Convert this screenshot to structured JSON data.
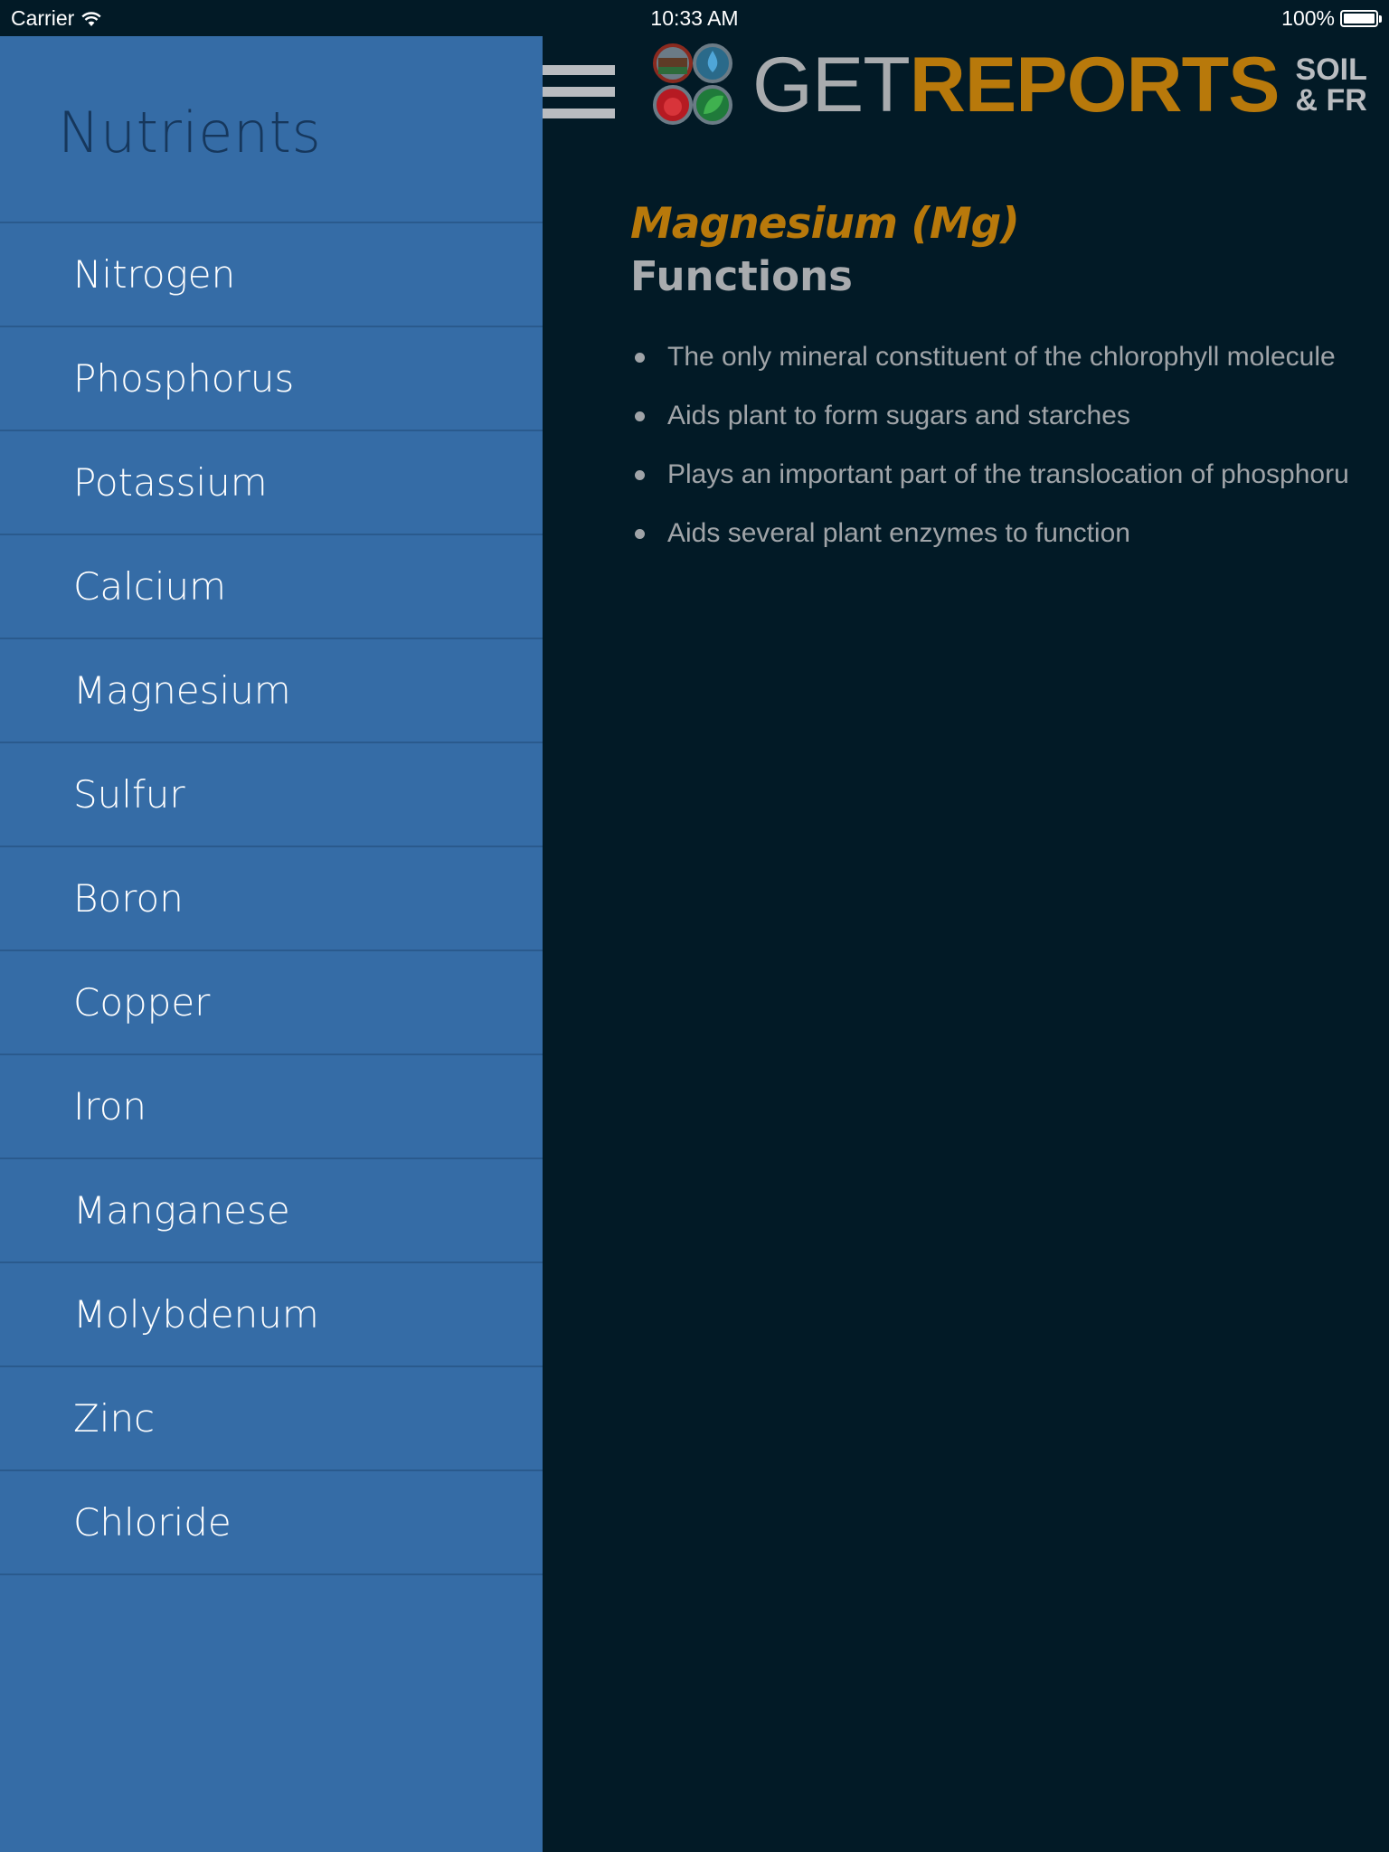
{
  "status_bar": {
    "carrier": "Carrier",
    "time": "10:33 AM",
    "battery": "100%",
    "battery_level": 1.0
  },
  "sidebar": {
    "title": "Nutrients",
    "items": [
      {
        "label": "Nitrogen"
      },
      {
        "label": "Phosphorus"
      },
      {
        "label": "Potassium"
      },
      {
        "label": "Calcium"
      },
      {
        "label": "Magnesium"
      },
      {
        "label": "Sulfur"
      },
      {
        "label": "Boron"
      },
      {
        "label": "Copper"
      },
      {
        "label": "Iron"
      },
      {
        "label": "Manganese"
      },
      {
        "label": "Molybdenum"
      },
      {
        "label": "Zinc"
      },
      {
        "label": "Chloride"
      }
    ]
  },
  "header": {
    "menu_icon": "hamburger-menu-icon",
    "logo": {
      "part1": "GET",
      "part2": "REPORTS",
      "tag_line1": "SOIL",
      "tag_line2": "& FR",
      "icon": "logo-droplets-icon"
    }
  },
  "content": {
    "title": "Magnesium (Mg)",
    "subtitle": "Functions",
    "bullets": [
      "The only mineral constituent of the chlorophyll molecule",
      "Aids plant to form sugars and starches",
      "Plays an important part of the translocation of phosphoru",
      "Aids several plant enzymes to function"
    ]
  },
  "colors": {
    "sidebar_bg": "#356ca6",
    "main_bg": "#021a26",
    "accent_orange": "#b8790b",
    "text_gray": "#a0a4a8"
  }
}
